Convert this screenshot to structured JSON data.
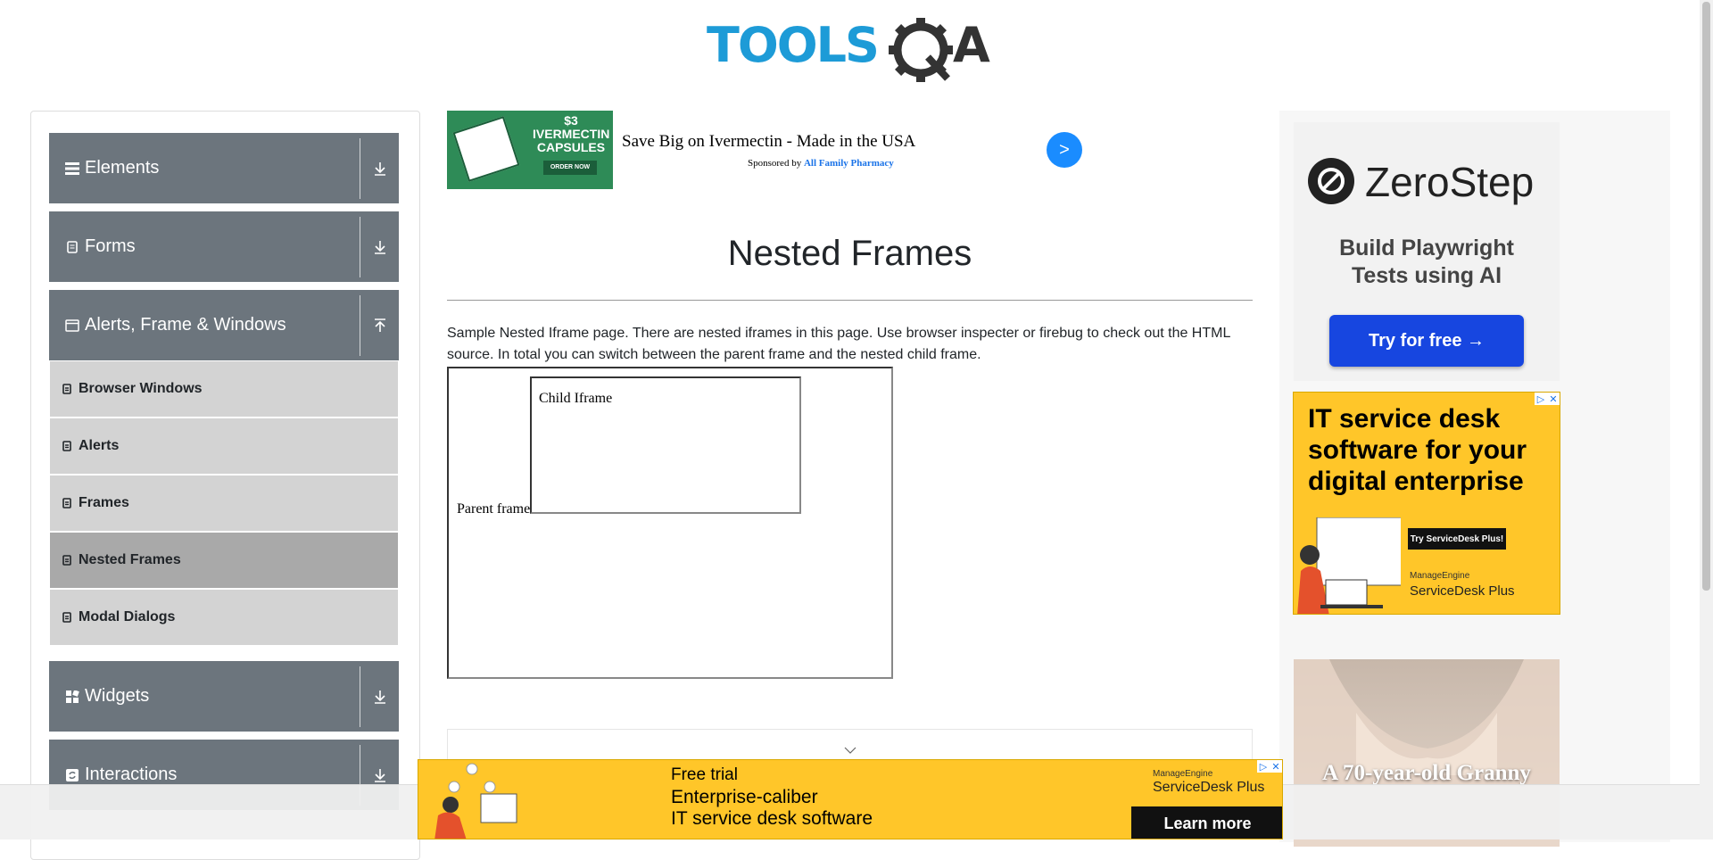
{
  "header": {
    "logo_text": "TOOLSQA"
  },
  "sidebar": {
    "groups": [
      {
        "label": "Elements",
        "icon": "menu-icon",
        "arrow": "download-icon"
      },
      {
        "label": "Forms",
        "icon": "file-icon",
        "arrow": "download-icon"
      },
      {
        "label": "Alerts, Frame & Windows",
        "icon": "window-icon",
        "arrow": "upload-icon"
      },
      {
        "label": "Widgets",
        "icon": "widgets-icon",
        "arrow": "download-icon"
      },
      {
        "label": "Interactions",
        "icon": "refresh-icon",
        "arrow": "download-icon"
      }
    ],
    "items": [
      {
        "label": "Browser Windows"
      },
      {
        "label": "Alerts"
      },
      {
        "label": "Frames"
      },
      {
        "label": "Nested Frames",
        "active": true
      },
      {
        "label": "Modal Dialogs"
      }
    ]
  },
  "top_ad": {
    "image_price": "$3",
    "image_title": "IVERMECTIN CAPSULES",
    "image_button": "ORDER NOW",
    "title": "Save Big on Ivermectin - Made in the USA",
    "sponsored_prefix": "Sponsored by",
    "sponsor": "All Family Pharmacy",
    "go_label": ">"
  },
  "main": {
    "title": "Nested Frames",
    "description": "Sample Nested Iframe page. There are nested iframes in this page. Use browser inspecter or firebug to check out the HTML source. In total you can switch between the parent frame and the nested child frame.",
    "parent_frame_label": "Parent frame",
    "child_frame_label": "Child Iframe"
  },
  "right_ads": {
    "zerostep": {
      "brand": "ZeroStep",
      "tagline_line1": "Build Playwright",
      "tagline_line2": "Tests using AI",
      "button": "Try for free →"
    },
    "servicedesk": {
      "headline_line1": "IT service desk",
      "headline_line2": "software for your",
      "headline_line3": "digital enterprise",
      "button": "Try ServiceDesk Plus!",
      "brand_small": "ManageEngine",
      "brand_big": "ServiceDesk Plus"
    },
    "granny": {
      "text": "A 70-year-old Granny"
    }
  },
  "bottom_ad": {
    "line1": "Free trial",
    "line2": "Enterprise-caliber",
    "line3": "IT service desk software",
    "brand_small": "ManageEngine",
    "brand_big": "ServiceDesk Plus",
    "button": "Learn more"
  },
  "colors": {
    "group_bg": "#6c757d",
    "item_bg": "#d3d3d3",
    "item_active_bg": "#a9a9a9",
    "logo_blue": "#1d9bd7",
    "logo_dark": "#333333",
    "ad_yellow": "#ffc629"
  }
}
